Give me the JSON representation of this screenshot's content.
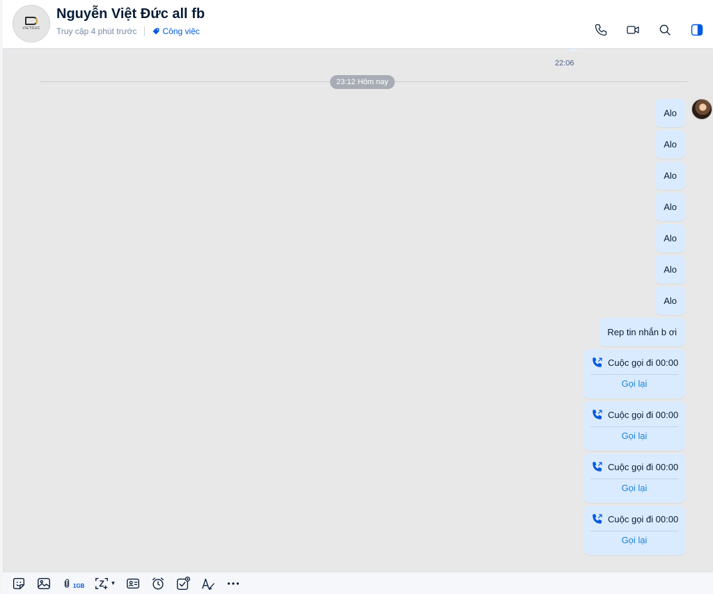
{
  "header": {
    "title": "Nguyễn Việt Đức all fb",
    "last_seen": "Truy cập 4 phút trước",
    "tag_label": "Công việc",
    "avatar_logo_text": "VIETDUC"
  },
  "chat": {
    "prev_message_time": "22:06",
    "date_divider": "23:12 Hôm nay",
    "messages": [
      {
        "text": "Alo"
      },
      {
        "text": "Alo"
      },
      {
        "text": "Alo"
      },
      {
        "text": "Alo"
      },
      {
        "text": "Alo"
      },
      {
        "text": "Alo"
      },
      {
        "text": "Alo"
      },
      {
        "text": "Rep tin nhắn b ơi"
      }
    ],
    "calls": [
      {
        "label": "Cuộc gọi đi 00:00",
        "action": "Gọi lại"
      },
      {
        "label": "Cuộc gọi đi 00:00",
        "action": "Gọi lại"
      },
      {
        "label": "Cuộc gọi đi 00:00",
        "action": "Gọi lại"
      },
      {
        "label": "Cuộc gọi đi 00:00",
        "action": "Gọi lại"
      }
    ]
  },
  "toolbar": {
    "file_size_limit": "1GB",
    "icons": [
      "sticker-icon",
      "image-icon",
      "attachment-icon",
      "screenshot-icon",
      "contact-card-icon",
      "reminder-icon",
      "task-icon",
      "text-format-icon",
      "more-icon"
    ]
  },
  "colors": {
    "accent": "#005ae0",
    "bubble": "#dbebff",
    "background": "#e8e8e8",
    "link": "#1a84d6"
  }
}
